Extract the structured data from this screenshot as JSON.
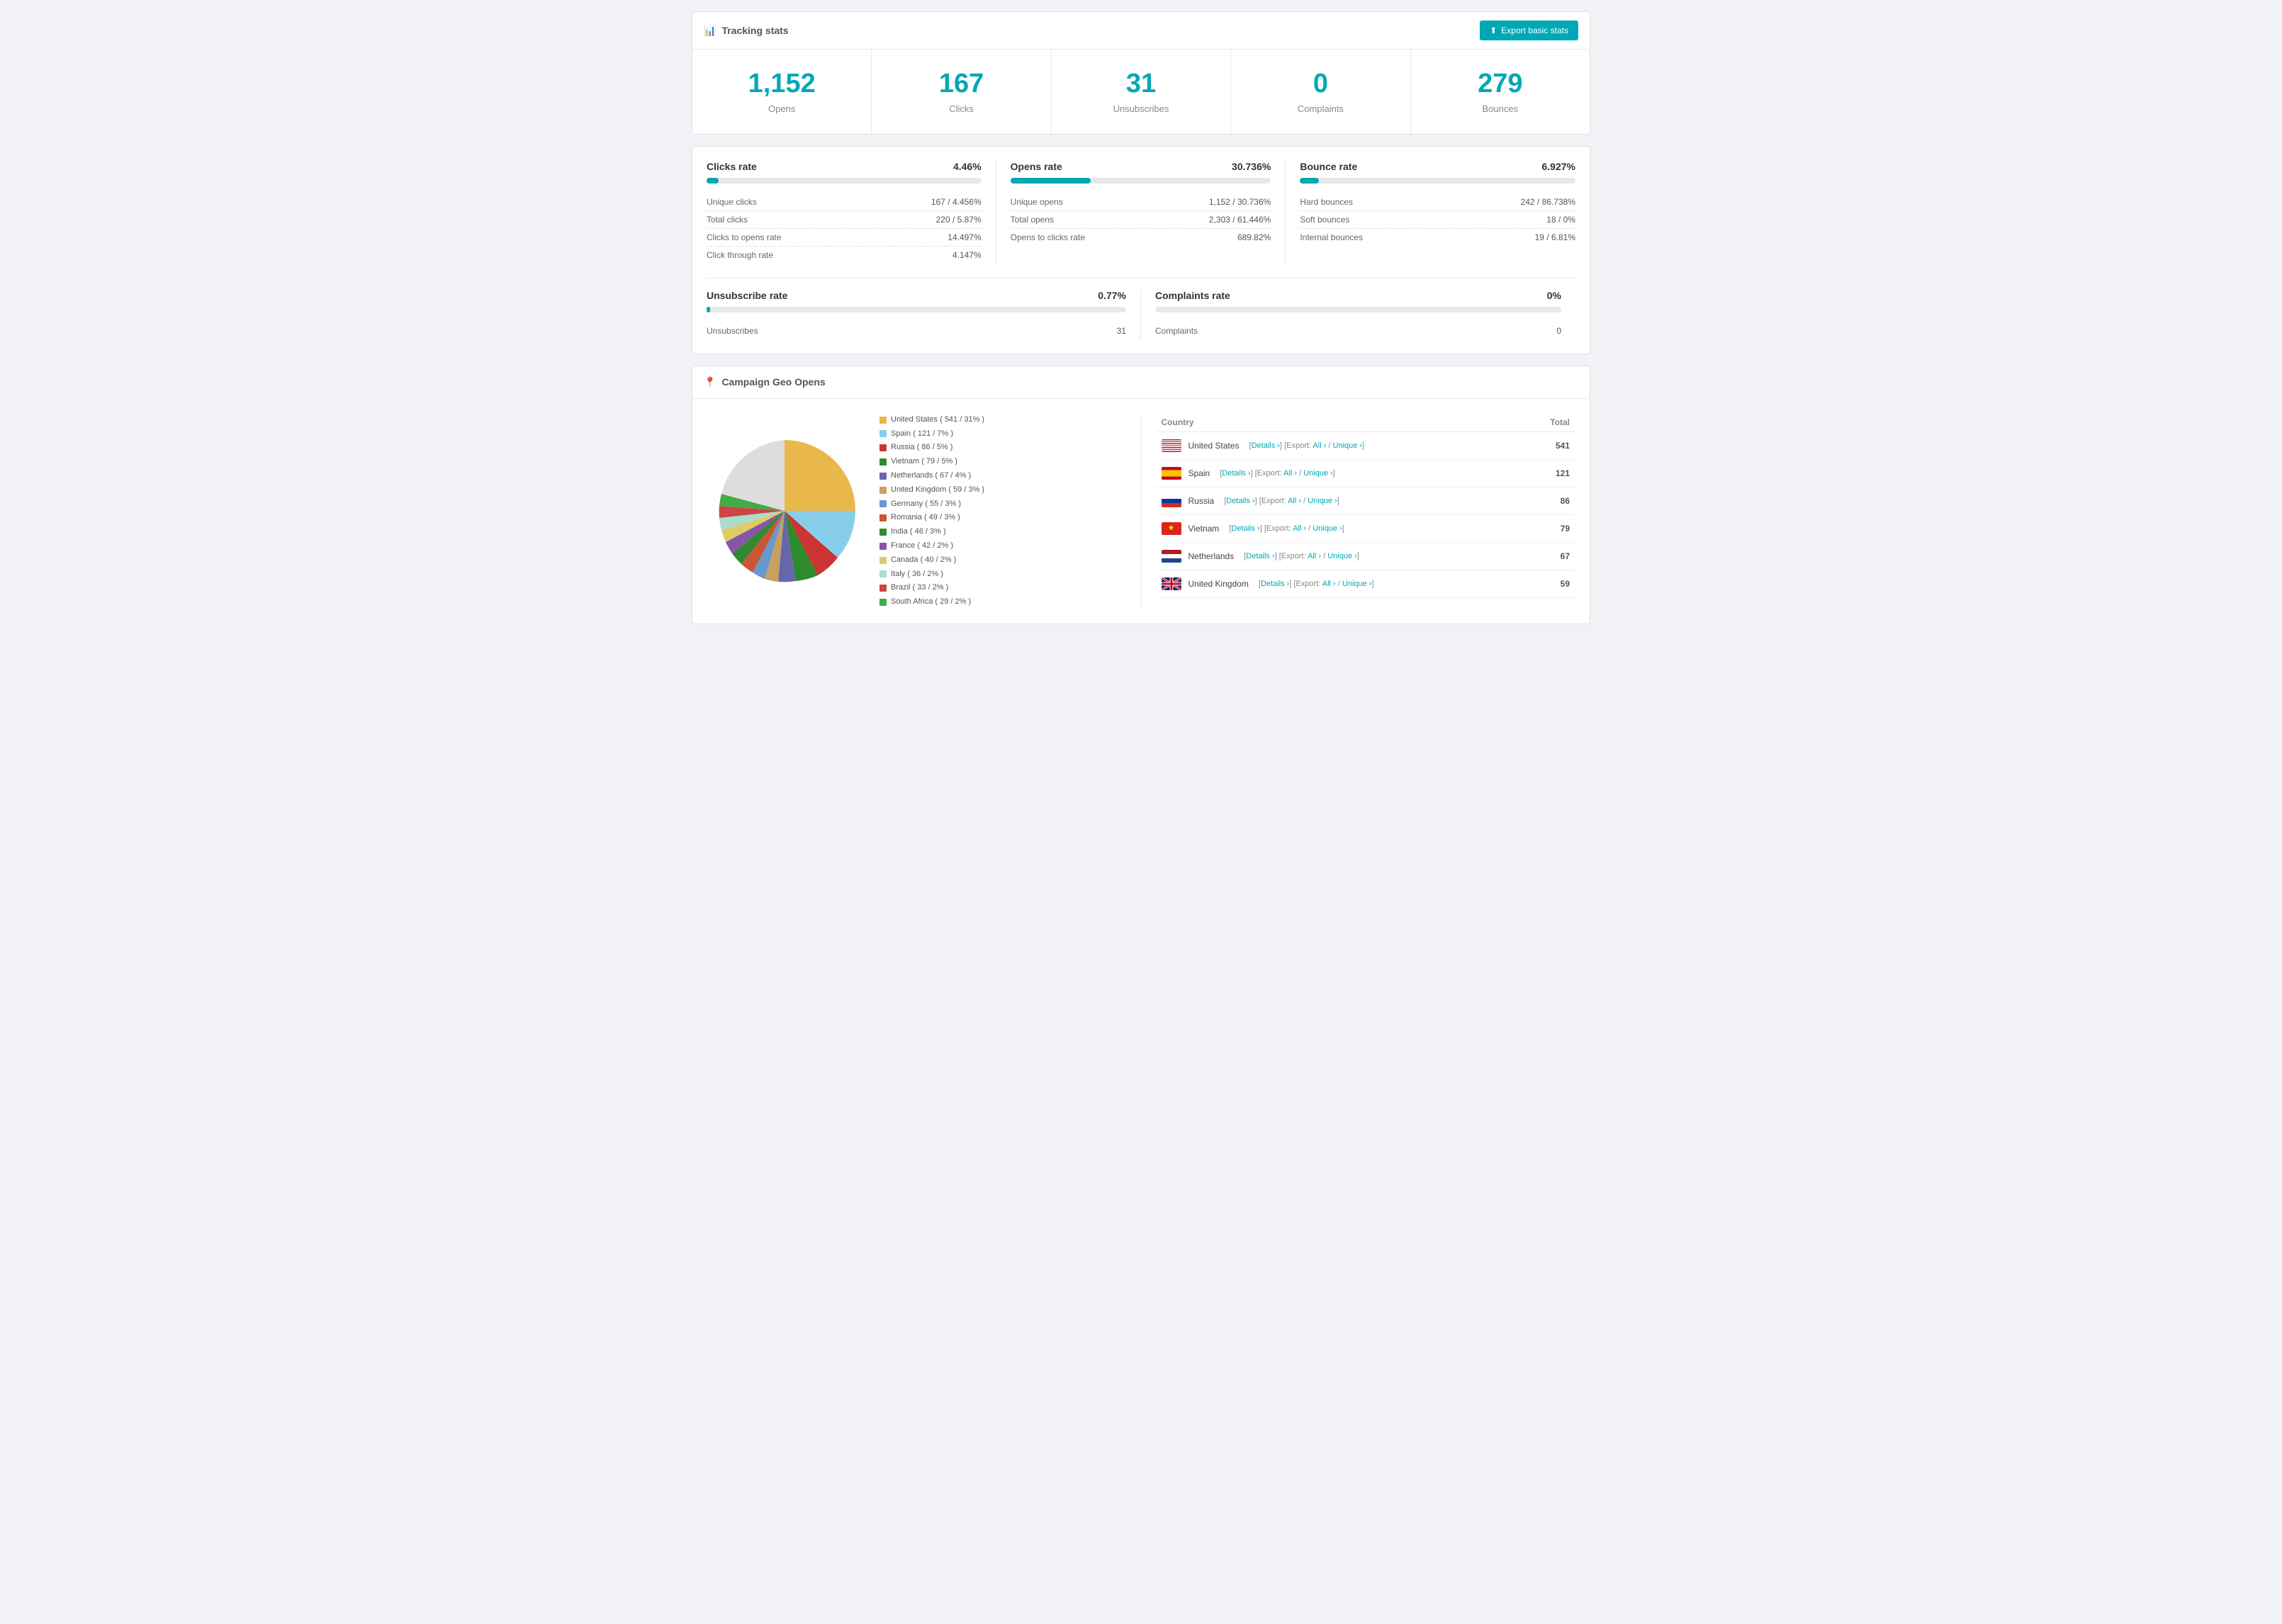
{
  "page": {
    "title": "Tracking stats",
    "export_button": "Export basic stats"
  },
  "stats": [
    {
      "number": "1,152",
      "label": "Opens"
    },
    {
      "number": "167",
      "label": "Clicks"
    },
    {
      "number": "31",
      "label": "Unsubscribes"
    },
    {
      "number": "0",
      "label": "Complaints"
    },
    {
      "number": "279",
      "label": "Bounces"
    }
  ],
  "rates": {
    "clicks": {
      "title": "Clicks rate",
      "value": "4.46%",
      "progress": 4.46,
      "rows": [
        {
          "label": "Unique clicks",
          "value": "167 / 4.456%"
        },
        {
          "label": "Total clicks",
          "value": "220 / 5.87%"
        },
        {
          "label": "Clicks to opens rate",
          "value": "14.497%"
        },
        {
          "label": "Click through rate",
          "value": "4.147%"
        }
      ]
    },
    "opens": {
      "title": "Opens rate",
      "value": "30.736%",
      "progress": 30.736,
      "rows": [
        {
          "label": "Unique opens",
          "value": "1,152 / 30.736%"
        },
        {
          "label": "Total opens",
          "value": "2,303 / 61.446%"
        },
        {
          "label": "Opens to clicks rate",
          "value": "689.82%"
        }
      ]
    },
    "bounce": {
      "title": "Bounce rate",
      "value": "6.927%",
      "progress": 6.927,
      "rows": [
        {
          "label": "Hard bounces",
          "value": "242 / 86.738%"
        },
        {
          "label": "Soft bounces",
          "value": "18 / 0%"
        },
        {
          "label": "Internal bounces",
          "value": "19 / 6.81%"
        }
      ]
    },
    "unsubscribe": {
      "title": "Unsubscribe rate",
      "value": "0.77%",
      "progress": 0.77,
      "rows": [
        {
          "label": "Unsubscribes",
          "value": "31"
        }
      ]
    },
    "complaints": {
      "title": "Complaints rate",
      "value": "0%",
      "progress": 0,
      "rows": [
        {
          "label": "Complaints",
          "value": "0"
        }
      ]
    }
  },
  "geo": {
    "title": "Campaign Geo Opens",
    "legend": [
      {
        "country": "United States",
        "value": "541 / 31%",
        "color": "#e8b84b"
      },
      {
        "country": "Spain",
        "value": "121 / 7%",
        "color": "#87ceeb"
      },
      {
        "country": "Russia",
        "value": "86 / 5%",
        "color": "#cc3333"
      },
      {
        "country": "Vietnam",
        "value": "79 / 5%",
        "color": "#2d8a2d"
      },
      {
        "country": "Netherlands",
        "value": "67 / 4%",
        "color": "#6666aa"
      },
      {
        "country": "United Kingdom",
        "value": "59 / 3%",
        "color": "#c8a060"
      },
      {
        "country": "Germany",
        "value": "55 / 3%",
        "color": "#6699cc"
      },
      {
        "country": "Romania",
        "value": "49 / 3%",
        "color": "#cc5533"
      },
      {
        "country": "India",
        "value": "46 / 3%",
        "color": "#338833"
      },
      {
        "country": "France",
        "value": "42 / 2%",
        "color": "#8855aa"
      },
      {
        "country": "Canada",
        "value": "40 / 2%",
        "color": "#ddcc66"
      },
      {
        "country": "Italy",
        "value": "36 / 2%",
        "color": "#aaddcc"
      },
      {
        "country": "Brazil",
        "value": "33 / 2%",
        "color": "#cc4444"
      },
      {
        "country": "South Africa",
        "value": "29 / 2%",
        "color": "#44aa44"
      }
    ],
    "table_headers": {
      "country": "Country",
      "total": "Total"
    },
    "table_rows": [
      {
        "country": "United States",
        "total": "541",
        "flag": "us",
        "details_link": "Details ›",
        "export_all": "All ›",
        "export_unique": "Unique ›"
      },
      {
        "country": "Spain",
        "total": "121",
        "flag": "es",
        "details_link": "Details ›",
        "export_all": "All ›",
        "export_unique": "Unique ›"
      },
      {
        "country": "Russia",
        "total": "86",
        "flag": "ru",
        "details_link": "Details ›",
        "export_all": "All ›",
        "export_unique": "Unique ›"
      },
      {
        "country": "Vietnam",
        "total": "79",
        "flag": "vn",
        "details_link": "Details ›",
        "export_all": "All ›",
        "export_unique": "Unique ›"
      },
      {
        "country": "Netherlands",
        "total": "67",
        "flag": "nl",
        "details_link": "Details ›",
        "export_all": "All ›",
        "export_unique": "Unique ›"
      },
      {
        "country": "United Kingdom",
        "total": "59",
        "flag": "gb",
        "details_link": "Details ›",
        "export_all": "All ›",
        "export_unique": "Unique ›"
      }
    ]
  }
}
